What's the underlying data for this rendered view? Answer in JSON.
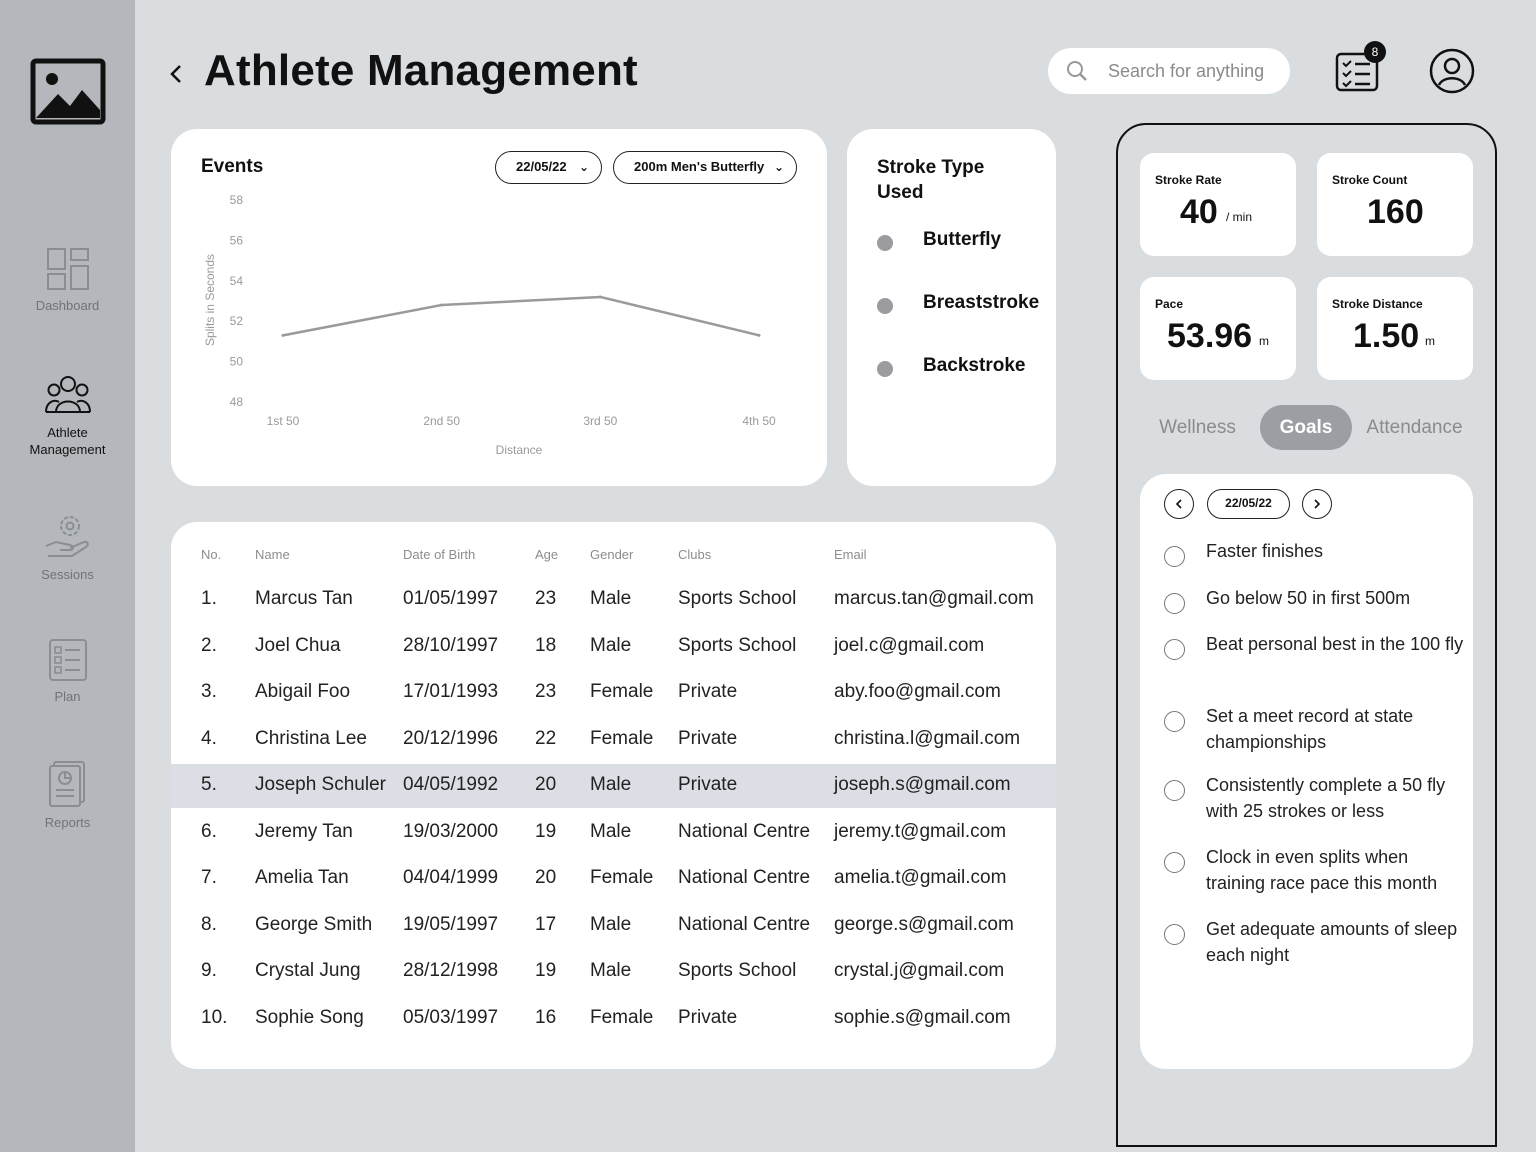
{
  "header": {
    "title": "Athlete Management",
    "search_placeholder": "Search for anything",
    "notification_count": "8"
  },
  "sidebar": {
    "items": [
      {
        "label": "Dashboard",
        "icon": "dashboard-icon"
      },
      {
        "label": "Athlete Management",
        "icon": "athletes-icon"
      },
      {
        "label": "Sessions",
        "icon": "sessions-icon"
      },
      {
        "label": "Plan",
        "icon": "plan-icon"
      },
      {
        "label": "Reports",
        "icon": "reports-icon"
      }
    ]
  },
  "events": {
    "title": "Events",
    "date_select": "22/05/22",
    "event_select": "200m Men's Butterfly"
  },
  "chart_data": {
    "type": "line",
    "categories": [
      "1st 50",
      "2nd 50",
      "3rd 50",
      "4th 50"
    ],
    "series": [
      {
        "values": [
          51.3,
          52.8,
          53.2,
          51.3
        ]
      }
    ],
    "xlabel": "Distance",
    "ylabel": "Splits in Seconds",
    "ylim": [
      48,
      58
    ],
    "yticks": [
      58,
      56,
      54,
      52,
      50,
      48
    ],
    "grid": false,
    "line_color": "#9a9a9a"
  },
  "stroke": {
    "title": "Stroke Type Used",
    "types": [
      "Butterfly",
      "Breaststroke",
      "Backstroke"
    ]
  },
  "table": {
    "headers": [
      "No.",
      "Name",
      "Date of Birth",
      "Age",
      "Gender",
      "Clubs",
      "Email"
    ],
    "rows": [
      [
        "1.",
        "Marcus Tan",
        "01/05/1997",
        "23",
        "Male",
        "Sports School",
        "marcus.tan@gmail.com"
      ],
      [
        "2.",
        "Joel Chua",
        "28/10/1997",
        "18",
        "Male",
        "Sports School",
        "joel.c@gmail.com"
      ],
      [
        "3.",
        "Abigail Foo",
        "17/01/1993",
        "23",
        "Female",
        "Private",
        "aby.foo@gmail.com"
      ],
      [
        "4.",
        "Christina Lee",
        "20/12/1996",
        "22",
        "Female",
        "Private",
        "christina.l@gmail.com"
      ],
      [
        "5.",
        "Joseph Schuler",
        "04/05/1992",
        "20",
        "Male",
        "Private",
        "joseph.s@gmail.com"
      ],
      [
        "6.",
        "Jeremy Tan",
        "19/03/2000",
        "19",
        "Male",
        "National Centre",
        "jeremy.t@gmail.com"
      ],
      [
        "7.",
        "Amelia Tan",
        "04/04/1999",
        "20",
        "Female",
        "National Centre",
        "amelia.t@gmail.com"
      ],
      [
        "8.",
        "George Smith",
        "19/05/1997",
        "17",
        "Male",
        "National Centre",
        "george.s@gmail.com"
      ],
      [
        "9.",
        "Crystal Jung",
        "28/12/1998",
        "19",
        "Male",
        "Sports School",
        "crystal.j@gmail.com"
      ],
      [
        "10.",
        "Sophie Song",
        "05/03/1997",
        "16",
        "Female",
        "Private",
        "sophie.s@gmail.com"
      ]
    ],
    "selected_row": 4
  },
  "metrics": {
    "stroke_rate": {
      "label": "Stroke Rate",
      "value": "40",
      "unit": "/ min"
    },
    "stroke_count": {
      "label": "Stroke Count",
      "value": "160"
    },
    "pace": {
      "label": "Pace",
      "value": "53.96",
      "unit": "m"
    },
    "stroke_distance": {
      "label": "Stroke Distance",
      "value": "1.50",
      "unit": "m"
    }
  },
  "tabs": [
    "Wellness",
    "Goals",
    "Attendance"
  ],
  "active_tab": "Goals",
  "goals": {
    "date": "22/05/22",
    "items": [
      "Faster finishes",
      "Go below 50 in first 500m",
      "Beat personal best in the 100 fly",
      "Set a meet record at state championships",
      "Consistently complete a 50 fly with 25 strokes or less",
      "Clock in even splits when training race pace this month",
      "Get adequate amounts of sleep each night"
    ]
  }
}
